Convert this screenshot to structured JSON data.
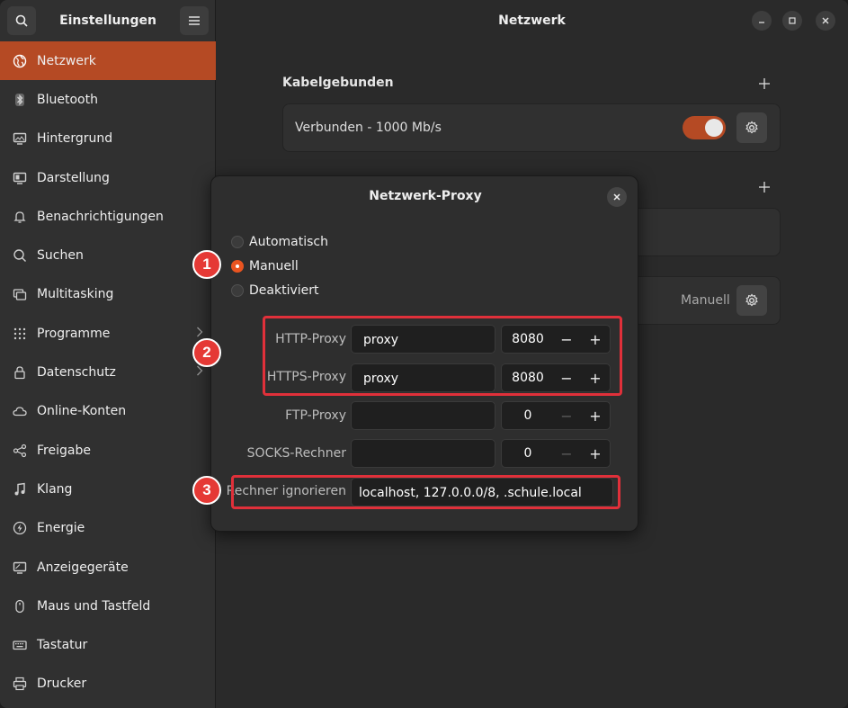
{
  "sidebar": {
    "title": "Einstellungen",
    "items": [
      {
        "label": "Netzwerk",
        "icon": "globe-icon",
        "active": true
      },
      {
        "label": "Bluetooth",
        "icon": "bluetooth-icon"
      },
      {
        "label": "Hintergrund",
        "icon": "monitor-icon"
      },
      {
        "label": "Darstellung",
        "icon": "appearance-icon"
      },
      {
        "label": "Benachrichtigungen",
        "icon": "bell-icon"
      },
      {
        "label": "Suchen",
        "icon": "search-icon"
      },
      {
        "label": "Multitasking",
        "icon": "multitasking-icon"
      },
      {
        "label": "Programme",
        "icon": "grid-icon",
        "chevron": true
      },
      {
        "label": "Datenschutz",
        "icon": "lock-icon",
        "chevron": true
      },
      {
        "label": "Online-Konten",
        "icon": "cloud-icon"
      },
      {
        "label": "Freigabe",
        "icon": "share-icon"
      },
      {
        "label": "Klang",
        "icon": "music-note-icon"
      },
      {
        "label": "Energie",
        "icon": "power-icon"
      },
      {
        "label": "Anzeigegeräte",
        "icon": "display-icon"
      },
      {
        "label": "Maus und Tastfeld",
        "icon": "mouse-icon"
      },
      {
        "label": "Tastatur",
        "icon": "keyboard-icon"
      },
      {
        "label": "Drucker",
        "icon": "printer-icon"
      }
    ]
  },
  "main": {
    "title": "Netzwerk",
    "wired": {
      "section_title": "Kabelgebunden",
      "status": "Verbunden - 1000 Mb/s",
      "enabled": true
    },
    "proxy_row": {
      "value": "Manuell"
    }
  },
  "dialog": {
    "title": "Netzwerk-Proxy",
    "methods": [
      {
        "label": "Automatisch",
        "checked": false
      },
      {
        "label": "Manuell",
        "checked": true
      },
      {
        "label": "Deaktiviert",
        "checked": false
      }
    ],
    "http": {
      "label": "HTTP-Proxy",
      "host": "proxy",
      "port": "8080"
    },
    "https": {
      "label": "HTTPS-Proxy",
      "host": "proxy",
      "port": "8080"
    },
    "ftp": {
      "label": "FTP-Proxy",
      "host": "",
      "port": "0"
    },
    "socks": {
      "label": "SOCKS-Rechner",
      "host": "",
      "port": "0"
    },
    "ignore": {
      "label": "Rechner ignorieren",
      "value": "localhost, 127.0.0.0/8, .schule.local"
    }
  },
  "annotations": {
    "badges": [
      "1",
      "2",
      "3"
    ],
    "color": "#e0303a"
  },
  "colors": {
    "accent": "#e95420",
    "active_sidebar": "#b54a24"
  }
}
